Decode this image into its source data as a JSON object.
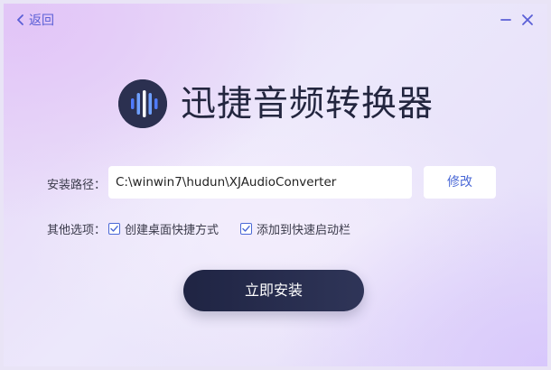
{
  "header": {
    "back_label": "返回"
  },
  "app": {
    "title": "迅捷音频转换器"
  },
  "install_path": {
    "label": "安装路径：",
    "value": "C:\\winwin7\\hudun\\XJAudioConverter",
    "modify_button": "修改"
  },
  "options": {
    "label": "其他选项：",
    "items": [
      {
        "label": "创建桌面快捷方式",
        "checked": true
      },
      {
        "label": "添加到快速启动栏",
        "checked": true
      }
    ]
  },
  "install_button": "立即安装",
  "colors": {
    "accent": "#4a68d6",
    "primary_dark": "#23263f",
    "logo_bars": "#5b8cff"
  },
  "icons": {
    "back": "chevron-left-icon",
    "minimize": "minimize-icon",
    "close": "close-icon",
    "logo": "audio-waveform-logo",
    "check": "checkmark-icon"
  }
}
